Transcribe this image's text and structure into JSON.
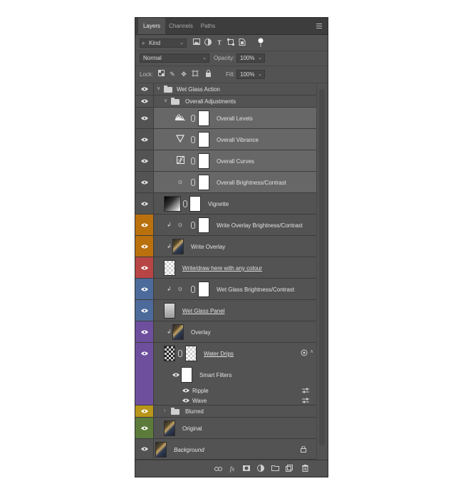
{
  "tabs": [
    {
      "label": "Layers"
    },
    {
      "label": "Channels"
    },
    {
      "label": "Paths"
    }
  ],
  "filter": {
    "kind": "Kind"
  },
  "blend": {
    "mode": "Normal",
    "opacity_label": "Opacity:",
    "opacity": "100%"
  },
  "lock": {
    "label": "Lock:",
    "fill_label": "Fill:",
    "fill": "100%"
  },
  "layers": [
    {
      "name": "Wet Glass Action",
      "color": "#535353"
    },
    {
      "name": "Overall Adjustments",
      "color": "#535353"
    },
    {
      "name": "Overall Levels",
      "color": "#535353"
    },
    {
      "name": "Overall Vibrance",
      "color": "#535353"
    },
    {
      "name": "Overall Curves",
      "color": "#535353"
    },
    {
      "name": "Overall Brightness/Contrast",
      "color": "#535353"
    },
    {
      "name": "Vignette",
      "color": "#535353"
    },
    {
      "name": "Write Overlay Brightness/Contrast",
      "color": "#b9700d"
    },
    {
      "name": "Write Overlay",
      "color": "#b9700d"
    },
    {
      "name": "Write/draw here with any colour",
      "color": "#b84545"
    },
    {
      "name": "Wet Glass Brightness/Contrast",
      "color": "#4d6b9a"
    },
    {
      "name": "Wet Glass Panel",
      "color": "#4d6b9a"
    },
    {
      "name": "Overlay",
      "color": "#6e4f9e"
    },
    {
      "name": "Water Drips",
      "color": "#6e4f9e"
    },
    {
      "name": "Smart Filters",
      "color": "#6e4f9e"
    },
    {
      "name": "Ripple",
      "color": "#6e4f9e"
    },
    {
      "name": "Wave",
      "color": "#6e4f9e"
    },
    {
      "name": "Blurred",
      "color": "#b8961a"
    },
    {
      "name": "Original",
      "color": "#5c7b3a"
    },
    {
      "name": "Background",
      "color": "#535353"
    }
  ],
  "icons": [
    "search-icon",
    "image-filter-icon",
    "adjustment-filter-icon",
    "type-filter-icon",
    "shape-filter-icon",
    "smart-object-filter-icon",
    "filter-toggle-icon",
    "lock-transparent-icon",
    "lock-image-icon",
    "lock-position-icon",
    "lock-artboard-icon",
    "lock-all-icon",
    "link-layers-icon",
    "fx-icon",
    "add-mask-icon",
    "new-adjustment-icon",
    "new-group-icon",
    "new-layer-icon",
    "delete-icon"
  ]
}
